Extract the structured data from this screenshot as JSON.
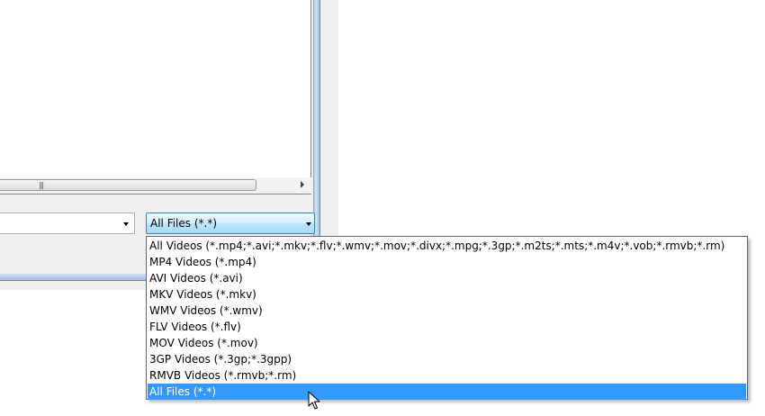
{
  "file_type_combo": {
    "selected_label": "All Files (*.*)"
  },
  "file_type_options": [
    {
      "label": "All Videos (*.mp4;*.avi;*.mkv;*.flv;*.wmv;*.mov;*.divx;*.mpg;*.3gp;*.m2ts;*.mts;*.m4v;*.vob;*.rmvb;*.rm)",
      "selected": false
    },
    {
      "label": "MP4 Videos (*.mp4)",
      "selected": false
    },
    {
      "label": "AVI Videos (*.avi)",
      "selected": false
    },
    {
      "label": "MKV Videos (*.mkv)",
      "selected": false
    },
    {
      "label": "WMV Videos (*.wmv)",
      "selected": false
    },
    {
      "label": "FLV Videos (*.flv)",
      "selected": false
    },
    {
      "label": "MOV Videos (*.mov)",
      "selected": false
    },
    {
      "label": "3GP Videos (*.3gp;*.3gpp)",
      "selected": false
    },
    {
      "label": "RMVB Videos (*.rmvb;*.rm)",
      "selected": false
    },
    {
      "label": "All Files (*.*)",
      "selected": true
    }
  ],
  "icons": {
    "scroll_grip": "|||",
    "cursor": "arrow-pointer-icon"
  },
  "colors": {
    "selection_highlight": "#3399ff",
    "combo_border_focus": "#3c7fb1",
    "window_frame": "#b9d1ea"
  }
}
